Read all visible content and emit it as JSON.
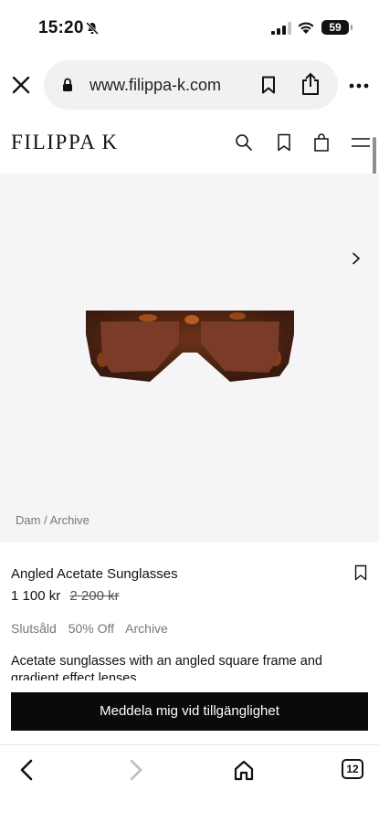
{
  "status_bar": {
    "time": "15:20",
    "battery": "59"
  },
  "browser": {
    "url": "www.filippa-k.com",
    "tab_count": "12"
  },
  "site": {
    "logo": "FILIPPA K"
  },
  "product": {
    "breadcrumb": "Dam / Archive",
    "title": "Angled Acetate Sunglasses",
    "price": "1 100 kr",
    "original_price": "2 200 kr",
    "tags": [
      "Slutsåld",
      "50% Off",
      "Archive"
    ],
    "description": "Acetate sunglasses with an angled square frame and gradient effect lenses.",
    "notify_label": "Meddela mig vid tillgänglighet"
  },
  "icons": {
    "status": [
      "bell-slash-icon",
      "signal-icon",
      "wifi-icon",
      "battery-icon"
    ],
    "url_bar": [
      "close-icon",
      "lock-icon",
      "bookmark-icon",
      "share-icon",
      "more-icon"
    ],
    "header": [
      "search-icon",
      "bookmark-icon",
      "bag-icon",
      "menu-icon"
    ],
    "toolbar": [
      "back-icon",
      "forward-icon",
      "home-icon",
      "tabs-icon"
    ]
  },
  "colors": {
    "button_bg": "#0a0a0a",
    "image_bg": "#f5f5f7",
    "frame": "#4a2414",
    "lens": "#7a3b28"
  }
}
